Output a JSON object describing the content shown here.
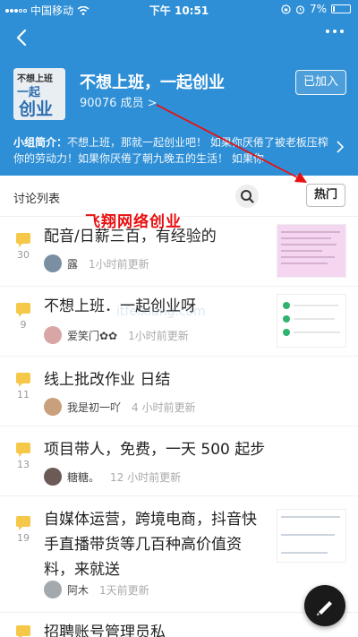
{
  "status_bar": {
    "carrier": "中国移动",
    "time": "下午 10:51",
    "battery": "7%"
  },
  "group": {
    "logo_text": "不想上班 一起创业",
    "title": "不想上班，一起创业",
    "members": "90076 成员 >",
    "joined_label": "已加入",
    "intro_label": "小组简介：",
    "intro_text": "不想上班，那就一起创业吧！ 如果你厌倦了被老板压榨你的劳动力！如果你厌倦了朝九晚五的生活！ 如果你"
  },
  "list": {
    "title": "讨论列表",
    "hot_label": "热门"
  },
  "watermark": {
    "title": "飞翔网络创业",
    "faint": "itfeixiang.com"
  },
  "posts": [
    {
      "count": "30",
      "title": "配音/日薪三百，有经验的",
      "author": "露",
      "time": "1小时前更新"
    },
    {
      "count": "9",
      "title": "不想上班．一起创业呀",
      "author": "爱笑门✿✿",
      "time": "1小时前更新"
    },
    {
      "count": "11",
      "title": "线上批改作业 日结",
      "author": "我是初一吖",
      "time": "4 小时前更新"
    },
    {
      "count": "13",
      "title": "项目带人，免费，一天 500 起步",
      "author": "糖糖。",
      "time": "12 小时前更新"
    },
    {
      "count": "19",
      "title": "自媒体运营，跨境电商，抖音快手直播带货等几百种高价值资料，来就送",
      "author": "阿木",
      "time": "1天前更新"
    },
    {
      "count": "",
      "title": "招聘账号管理员私",
      "author": "",
      "time": ""
    }
  ]
}
